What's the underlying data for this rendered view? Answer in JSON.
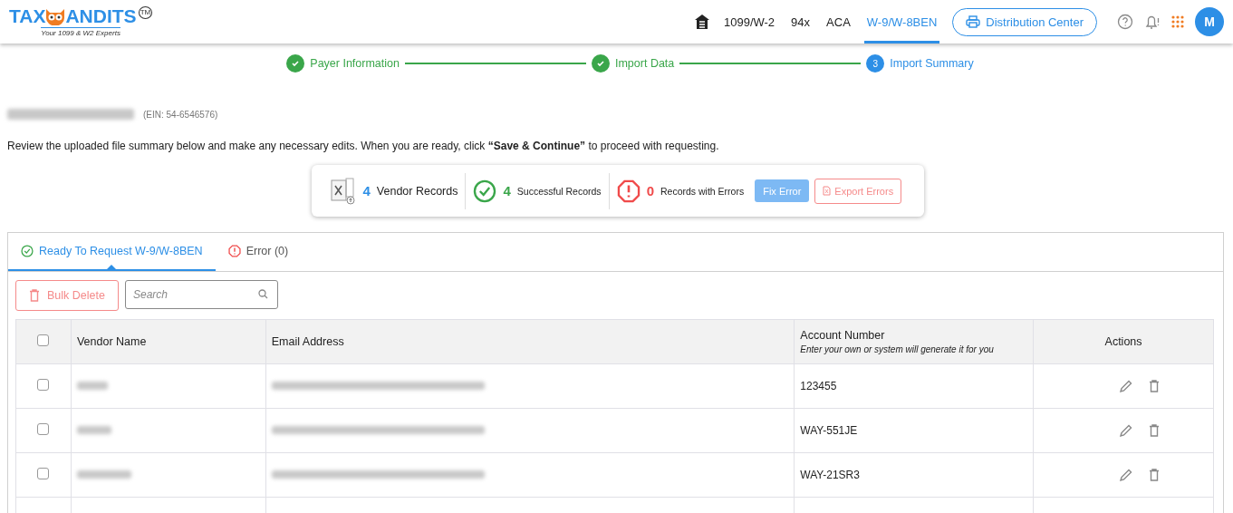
{
  "logo": {
    "left": "TAX",
    "right": "ANDITS",
    "trademark": "TM",
    "tagline": "Your 1099 & W2 Experts"
  },
  "nav": [
    {
      "label": "1099/W-2",
      "selected": false
    },
    {
      "label": "94x",
      "selected": false
    },
    {
      "label": "ACA",
      "selected": false
    },
    {
      "label": "W-9/W-8BEN",
      "selected": true
    }
  ],
  "distribution_button": "Distribution Center",
  "avatar": "M",
  "steps": [
    {
      "label": "Payer Information",
      "completed": true
    },
    {
      "label": "Import Data",
      "completed": true
    },
    {
      "label": "Import Summary",
      "completed": false,
      "number": "3"
    }
  ],
  "company": {
    "ein": "(EIN: 54-6546576)"
  },
  "intro": "Review the uploaded file summary below and make any necessary edits. When you are ready, click **“Save & Continue”** to proceed with requesting.",
  "summary": [
    {
      "kind": "file",
      "count": "4",
      "label": "Vendor Records"
    },
    {
      "kind": "success",
      "count": "4",
      "label": "Successful Records"
    },
    {
      "kind": "error",
      "count": "0",
      "label": "Records with Errors"
    }
  ],
  "fix_button": {
    "label": "Fix Error",
    "disabled": true
  },
  "export_button": "Export Errors",
  "tabs": [
    {
      "kind": "success",
      "label": "Ready To Request W-9/W-8BEN",
      "selected": true
    },
    {
      "kind": "error",
      "label": "Error (0)",
      "selected": false
    }
  ],
  "bulk_delete": "Bulk Delete",
  "search": {
    "placeholder": "Search"
  },
  "table": {
    "header_checked": false,
    "columns": [
      "Vendor Name",
      "Email Address",
      "Account Number",
      "Actions"
    ],
    "account_hint": "Enter your own or system will generate it for you",
    "rows": [
      {
        "checked": false,
        "account": "123455"
      },
      {
        "checked": false,
        "account": "WAY-551JE"
      },
      {
        "checked": false,
        "account": "WAY-21SR3"
      }
    ]
  }
}
